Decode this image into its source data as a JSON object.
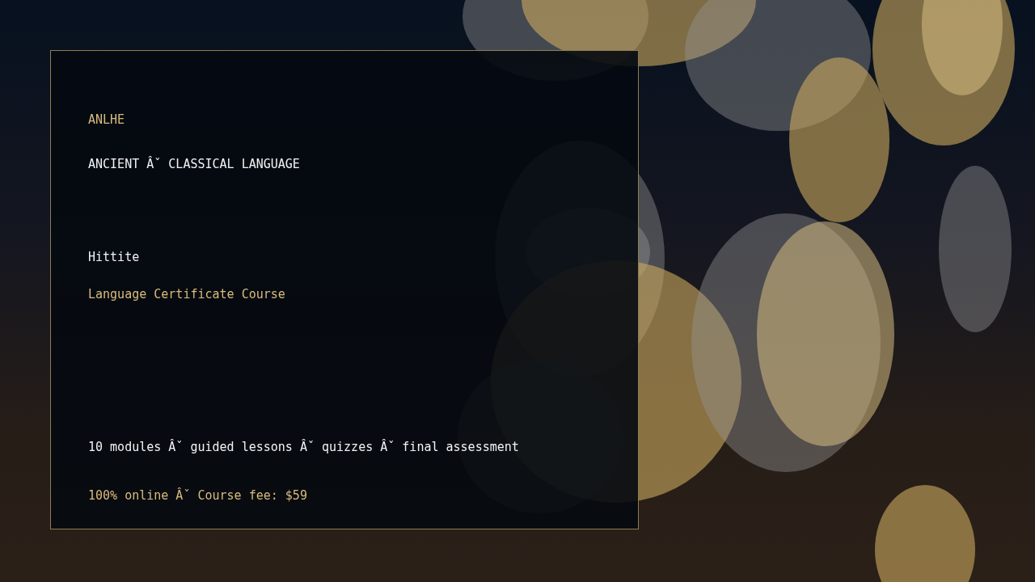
{
  "brand": "ANLHE",
  "category": "ANCIENT Âˇ CLASSICAL LANGUAGE",
  "language": "Hittite",
  "course_type": "Language Certificate Course",
  "features": "10 modules Âˇ guided lessons Âˇ quizzes Âˇ final assessment",
  "pricing": "100% online Âˇ Course fee: $59"
}
